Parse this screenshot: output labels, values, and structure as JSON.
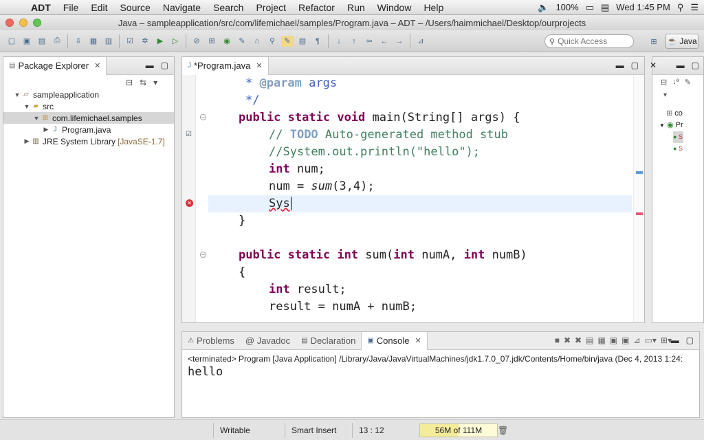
{
  "menubar": {
    "app": "ADT",
    "items": [
      "File",
      "Edit",
      "Source",
      "Navigate",
      "Search",
      "Project",
      "Refactor",
      "Run",
      "Window",
      "Help"
    ],
    "battery": "100%",
    "clock": "Wed 1:45 PM"
  },
  "window": {
    "title": "Java – sampleapplication/src/com/lifemichael/samples/Program.java – ADT – /Users/haimmichael/Desktop/ourprojects"
  },
  "toolbar": {
    "quick_access_placeholder": "Quick Access",
    "perspective": "Java"
  },
  "package_explorer": {
    "tab": "Package Explorer",
    "tree": [
      {
        "label": "sampleapplication",
        "indent": 0,
        "icon": "project-icon",
        "twisty": "▼"
      },
      {
        "label": "src",
        "indent": 1,
        "icon": "folder-icon",
        "twisty": "▼"
      },
      {
        "label": "com.lifemichael.samples",
        "indent": 2,
        "icon": "package-icon",
        "twisty": "▼",
        "selected": true
      },
      {
        "label": "Program.java",
        "indent": 3,
        "icon": "java-file-icon",
        "twisty": "▶"
      },
      {
        "label": "JRE System Library",
        "suffix": "[JavaSE-1.7]",
        "indent": 1,
        "icon": "library-icon",
        "twisty": "▶"
      }
    ]
  },
  "editor": {
    "tab": "*Program.java",
    "lines": [
      " * @param args",
      " */",
      "public static void main(String[] args) {",
      "    // TODO Auto-generated method stub",
      "    //System.out.println(\"hello\");",
      "    int num;",
      "    num = sum(3,4);",
      "    Sys",
      "}",
      "",
      "public static int sum(int numA, int numB)",
      "{",
      "    int result;",
      "    result = numA + numB;"
    ]
  },
  "outline": {
    "items": [
      "co",
      "Pr",
      "S",
      "S"
    ]
  },
  "console": {
    "tabs": [
      "Problems",
      "@ Javadoc",
      "Declaration",
      "Console"
    ],
    "header": "<terminated> Program [Java Application] /Library/Java/JavaVirtualMachines/jdk1.7.0_07.jdk/Contents/Home/bin/java (Dec 4, 2013 1:24:",
    "output": "hello"
  },
  "statusbar": {
    "mode": "Writable",
    "insert": "Smart Insert",
    "position": "13 : 12",
    "heap": "56M of 111M",
    "heap_used_fraction": 0.5
  }
}
